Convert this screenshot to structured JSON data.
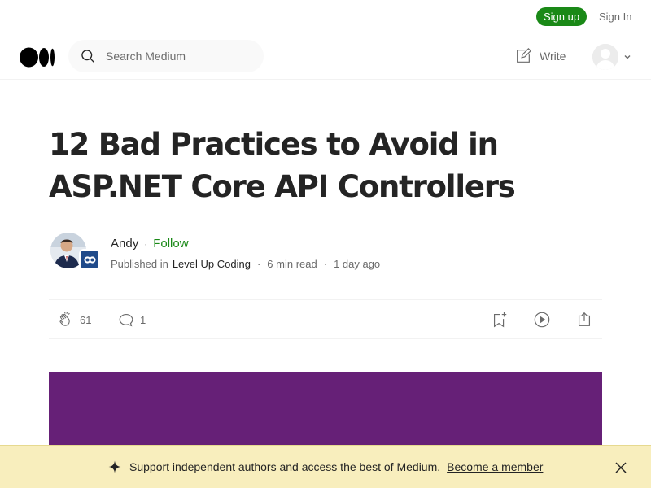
{
  "auth": {
    "signup_label": "Sign up",
    "signin_label": "Sign In"
  },
  "header": {
    "search_placeholder": "Search Medium",
    "write_label": "Write"
  },
  "article": {
    "title_line1": "12 Bad Practices to Avoid in",
    "title_line2": "ASP.NET Core API Controllers",
    "author": "Andy",
    "follow_label": "Follow",
    "published_in_label": "Published in",
    "publication": "Level Up Coding",
    "read_time": "6 min read",
    "published_ago": "1 day ago",
    "claps": "61",
    "responses": "1"
  },
  "banner": {
    "text": "Support independent authors and access the best of Medium.",
    "cta": "Become a member"
  },
  "colors": {
    "brand_green": "#1a8917",
    "hero_purple": "#662077",
    "banner_bg": "#f8eebd"
  },
  "icons": [
    "medium-logo-icon",
    "search-icon",
    "write-icon",
    "user-avatar-icon",
    "chevron-down-icon",
    "clap-icon",
    "comment-icon",
    "bookmark-add-icon",
    "play-icon",
    "share-icon",
    "sparkle-icon",
    "close-icon"
  ]
}
